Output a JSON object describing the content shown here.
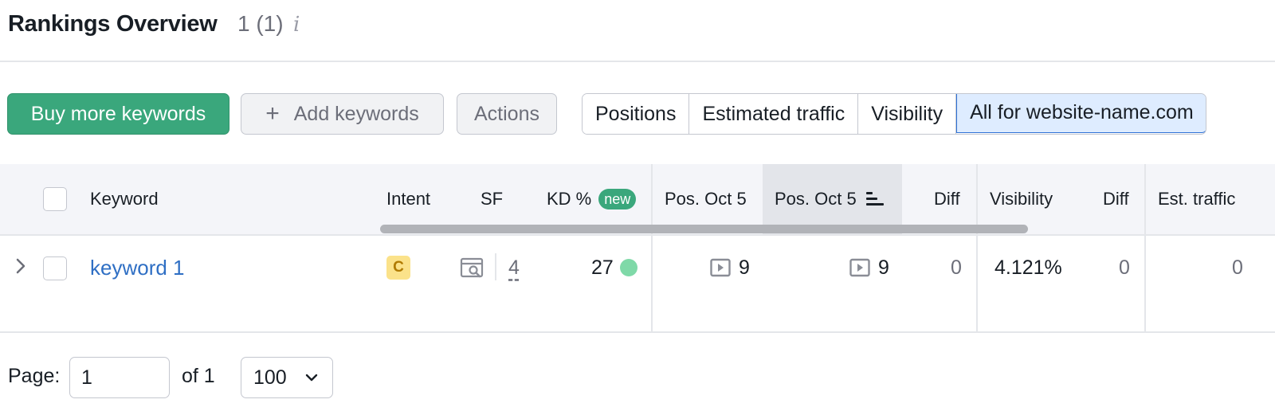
{
  "header": {
    "title": "Rankings Overview",
    "count": "1 (1)",
    "info_icon": "i"
  },
  "toolbar": {
    "buy_label": "Buy more keywords",
    "add_plus": "+",
    "add_label": "Add keywords",
    "actions_label": "Actions",
    "segments": [
      "Positions",
      "Estimated traffic",
      "Visibility",
      "All for website-name.com"
    ],
    "active_segment": "All for website-name.com"
  },
  "table": {
    "columns": {
      "keyword": "Keyword",
      "intent": "Intent",
      "sf": "SF",
      "kd": "KD %",
      "kd_badge": "new",
      "pos1": "Pos. Oct 5",
      "pos2": "Pos. Oct 5",
      "diff1": "Diff",
      "visibility": "Visibility",
      "diff2": "Diff",
      "est_traffic": "Est. traffic"
    },
    "rows": [
      {
        "keyword": "keyword 1",
        "intent": "C",
        "sf_count": "4",
        "kd": "27",
        "pos1": "9",
        "pos2": "9",
        "diff1": "0",
        "visibility": "4.121%",
        "diff2": "0",
        "est_traffic": "0"
      }
    ]
  },
  "pager": {
    "label": "Page:",
    "page_value": "1",
    "of_text": "of 1",
    "per_page": "100"
  },
  "colors": {
    "primary_green": "#3aa77c",
    "link_blue": "#2f6fc4",
    "active_segment_bg": "#deecff",
    "kd_dot": "#7fd9a8",
    "intent_badge": "#fbe28a"
  }
}
